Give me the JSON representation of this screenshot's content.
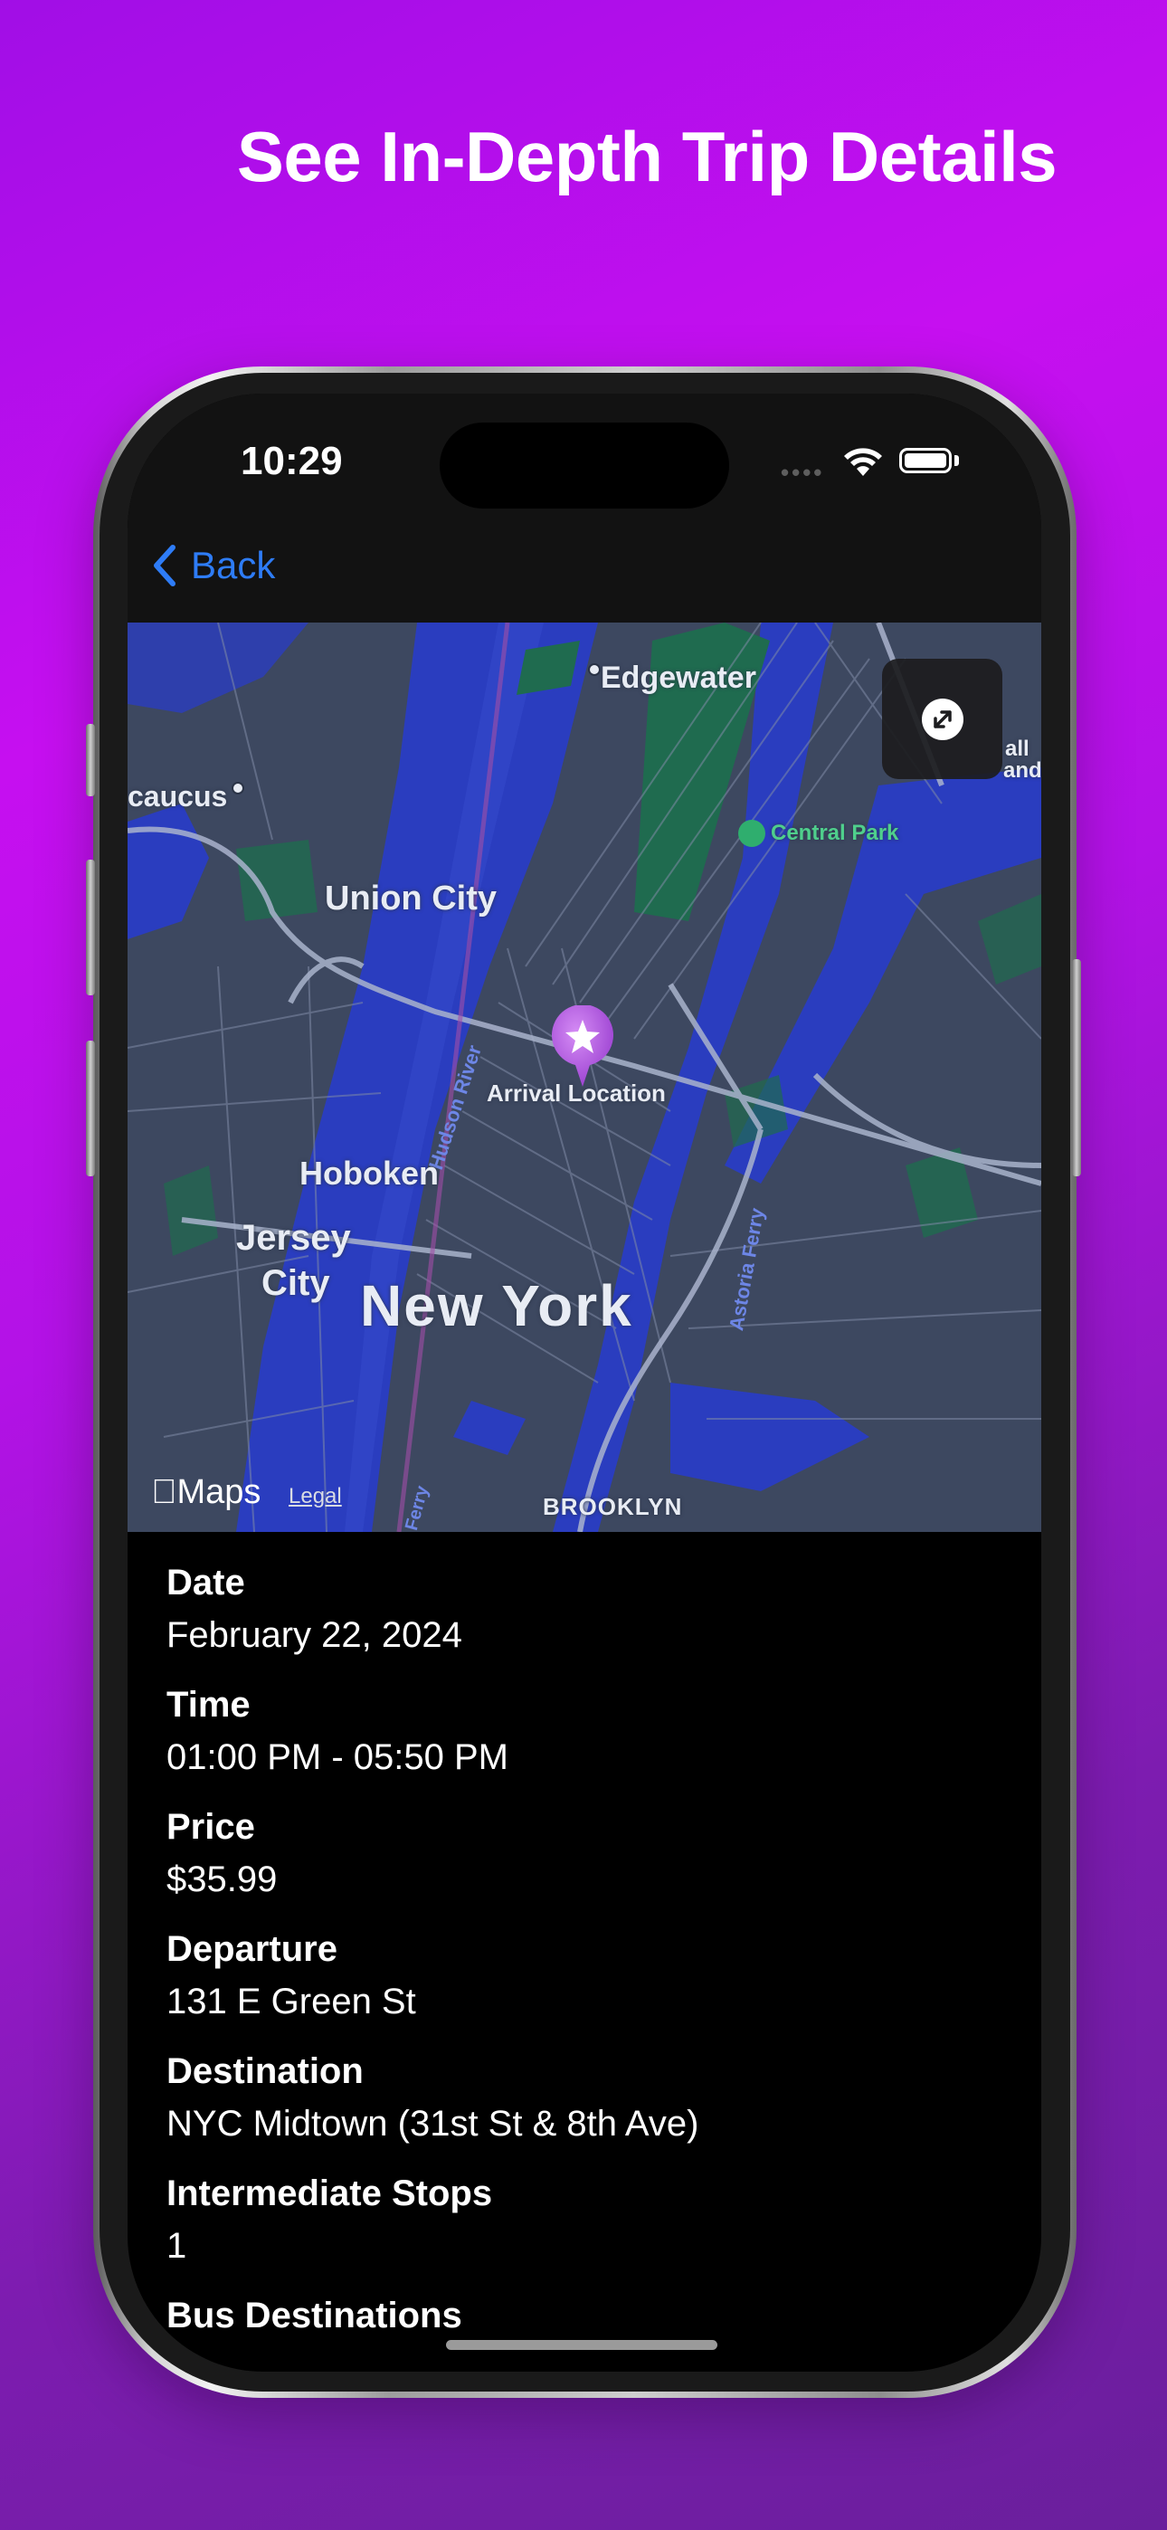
{
  "headline": "See In-Depth Trip Details",
  "status_bar": {
    "time": "10:29"
  },
  "nav": {
    "back_label": "Back"
  },
  "map": {
    "labels": {
      "edgewater": "Edgewater",
      "caucus": "caucus",
      "central_park": "Central Park",
      "union_city": "Union City",
      "hudson_river": "Hudson River",
      "arrival": "Arrival Location",
      "hoboken": "Hoboken",
      "astoria_ferry": "Astoria Ferry",
      "jersey": "Jersey",
      "city": "City",
      "new_york": "New York",
      "brooklyn": "BROOKLYN",
      "ferry": "Ferry",
      "randall": "all",
      "island": "and"
    },
    "attribution": "Maps",
    "legal": "Legal"
  },
  "details": [
    {
      "label": "Date",
      "value": "February 22, 2024"
    },
    {
      "label": "Time",
      "value": "01:00 PM - 05:50 PM"
    },
    {
      "label": "Price",
      "value": "$35.99"
    },
    {
      "label": "Departure",
      "value": "131 E Green St"
    },
    {
      "label": "Destination",
      "value": "NYC Midtown (31st St & 8th Ave)"
    },
    {
      "label": "Intermediate Stops",
      "value": "1"
    },
    {
      "label": "Bus Destinations",
      "value": ""
    }
  ],
  "colors": {
    "accent": "#2e7cf6",
    "pin": "#b55ee6",
    "map_water": "#2a3dbf",
    "map_land": "#3d4860",
    "park": "#1f6b4f"
  }
}
